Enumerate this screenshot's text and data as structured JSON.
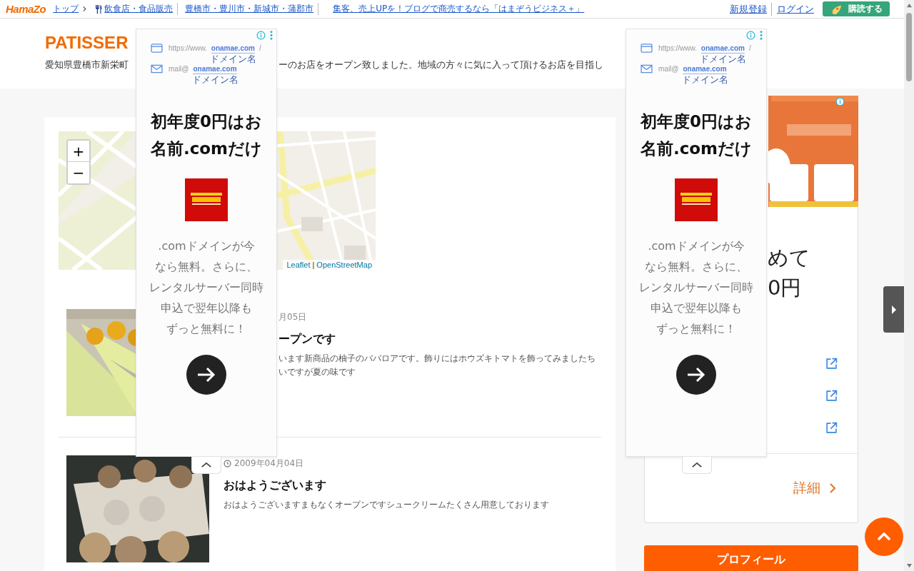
{
  "top_bar": {
    "logo": "HamaZo",
    "breadcrumbs": [
      {
        "label": "トップ",
        "kind": "root"
      },
      {
        "label": "飲食店・食品販売",
        "kind": "category"
      },
      {
        "label": "豊橋市・豊川市・新城市・蒲郡市",
        "kind": "area"
      }
    ],
    "promo_link": "集客、売上UPを！ブログで商売するなら「はまぞうビジネス＋」",
    "register": "新規登録",
    "login": "ログイン",
    "subscribe": "購読する"
  },
  "header": {
    "title": "PATISSER",
    "description_parts": [
      "愛知県豊橋市新栄町",
      "ーのお店をオープン致しました。地域の方々に気に入って頂けるお店を目指し"
    ]
  },
  "map": {
    "zoom_in": "+",
    "zoom_out": "−",
    "attribution": [
      "Leaflet",
      "OpenStreetMap"
    ],
    "attribution_separator": "|"
  },
  "posts": [
    {
      "kind": "covered",
      "date": "月05日",
      "title": "ープンです",
      "excerpt": [
        "います新商品の柚子のババロアです。飾りにはホウズキトマトを飾ってみましたち",
        "いですが夏の味です"
      ]
    },
    {
      "kind": "full",
      "date": "2009年04月04日",
      "title": "おはようございます",
      "excerpt": [
        "おはようございますまもなくオープンですシュークリームたくさん用意しております"
      ]
    }
  ],
  "sidebar": {
    "card_text": [
      "めて",
      "0円"
    ],
    "detail_link": "詳細",
    "profile_button": "プロフィール"
  },
  "ads": [
    {
      "url_prefix": "https://www.",
      "domain": "onamae.com",
      "url_suffix": "/",
      "domain_caption": "ドメイン名",
      "mail_prefix": "mail@",
      "mail_domain": "onamae.com",
      "mail_caption": "ドメイン名",
      "headline": [
        "初年度0円はお",
        "名前.comだけ"
      ],
      "body": [
        ".comドメインが今",
        "なら無料。さらに、",
        "レンタルサーバー同時",
        "申込で翌年以降も",
        "ずっと無料に！"
      ]
    },
    {
      "url_prefix": "https://www.",
      "domain": "onamae.com",
      "url_suffix": "/",
      "domain_caption": "ドメイン名",
      "mail_prefix": "mail@",
      "mail_domain": "onamae.com",
      "mail_caption": "ドメイン名",
      "headline": [
        "初年度0円はお",
        "名前.comだけ"
      ],
      "body": [
        ".comドメインが今",
        "なら無料。さらに、",
        "レンタルサーバー同時",
        "申込で翌年以降も",
        "ずっと無料に！"
      ]
    }
  ]
}
